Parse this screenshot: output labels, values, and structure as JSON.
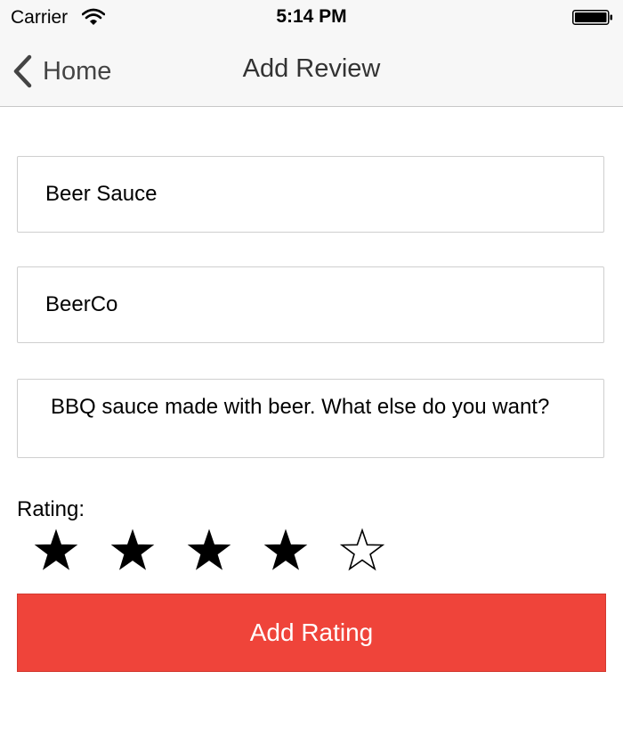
{
  "status_bar": {
    "carrier": "Carrier",
    "time": "5:14 PM",
    "icons": [
      "wifi-icon",
      "battery-icon"
    ]
  },
  "nav": {
    "back_label": "Home",
    "back_icon": "chevron-left-icon",
    "title": "Add Review"
  },
  "form": {
    "name_value": "Beer Sauce",
    "brand_value": "BeerCo",
    "review_value": "BBQ sauce made with beer. What else do you want?",
    "rating_label": "Rating:",
    "rating": 4,
    "max_rating": 5,
    "filled_star": "★",
    "empty_star": "☆",
    "submit_label": "Add Rating"
  },
  "colors": {
    "accent": "#ef443a",
    "bar_background": "#f7f7f7"
  }
}
